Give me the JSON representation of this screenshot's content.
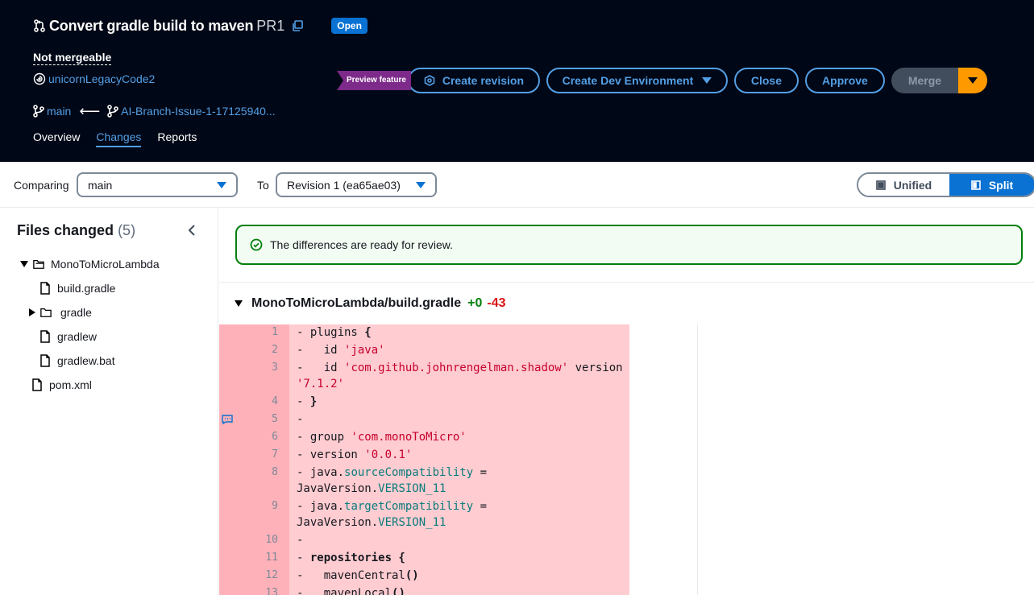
{
  "header": {
    "title": "Convert gradle build to maven",
    "pr_id": "PR1",
    "status": "Open",
    "mergeable": "Not mergeable",
    "repo": "unicornLegacyCode2",
    "destination_branch": "main",
    "source_branch": "AI-Branch-Issue-1-17125940...",
    "tabs": [
      "Overview",
      "Changes",
      "Reports"
    ],
    "active_tab": "Changes",
    "preview_badge": "Preview feature",
    "buttons": {
      "create_revision": "Create revision",
      "create_dev_env": "Create Dev Environment",
      "close": "Close",
      "approve": "Approve",
      "merge": "Merge"
    },
    "colors": {
      "background": "#000716",
      "link": "#539fe5",
      "merge_dropdown": "#ff9900",
      "badge": "#0972d3"
    }
  },
  "compare": {
    "comparing_label": "Comparing",
    "comparing_value": "main",
    "to_label": "To",
    "to_value": "Revision 1 (ea65ae03)",
    "view_modes": [
      "Unified",
      "Split"
    ],
    "active_view": "Split"
  },
  "sidebar": {
    "title": "Files changed",
    "count": "(5)",
    "tree": [
      {
        "label": "MonoToMicroLambda",
        "type": "folder",
        "expanded": true,
        "depth": 0
      },
      {
        "label": "build.gradle",
        "type": "file",
        "depth": 1
      },
      {
        "label": "gradle",
        "type": "folder",
        "expanded": false,
        "depth": 1
      },
      {
        "label": "gradlew",
        "type": "file",
        "depth": 1
      },
      {
        "label": "gradlew.bat",
        "type": "file",
        "depth": 1
      },
      {
        "label": "pom.xml",
        "type": "file",
        "depth": 0
      }
    ]
  },
  "main": {
    "alert": "The differences are ready for review.",
    "file": {
      "path": "MonoToMicroLambda/build.gradle",
      "additions": "+0",
      "deletions": "-43"
    },
    "lines": [
      {
        "n": "1",
        "text": "- plugins {"
      },
      {
        "n": "2",
        "text": "-   id 'java'"
      },
      {
        "n": "3",
        "text": "-   id 'com.github.johnrengelman.shadow' version '7.1.2'"
      },
      {
        "n": "4",
        "text": "- }"
      },
      {
        "n": "5",
        "text": "-"
      },
      {
        "n": "6",
        "text": "- group 'com.monoToMicro'"
      },
      {
        "n": "7",
        "text": "- version '0.0.1'"
      },
      {
        "n": "8",
        "text": "- java.sourceCompatibility = JavaVersion.VERSION_11"
      },
      {
        "n": "9",
        "text": "- java.targetCompatibility = JavaVersion.VERSION_11"
      },
      {
        "n": "10",
        "text": "-"
      },
      {
        "n": "11",
        "text": "- repositories {"
      },
      {
        "n": "12",
        "text": "-   mavenCentral()"
      },
      {
        "n": "13",
        "text": "-   mavenLocal()"
      }
    ]
  }
}
